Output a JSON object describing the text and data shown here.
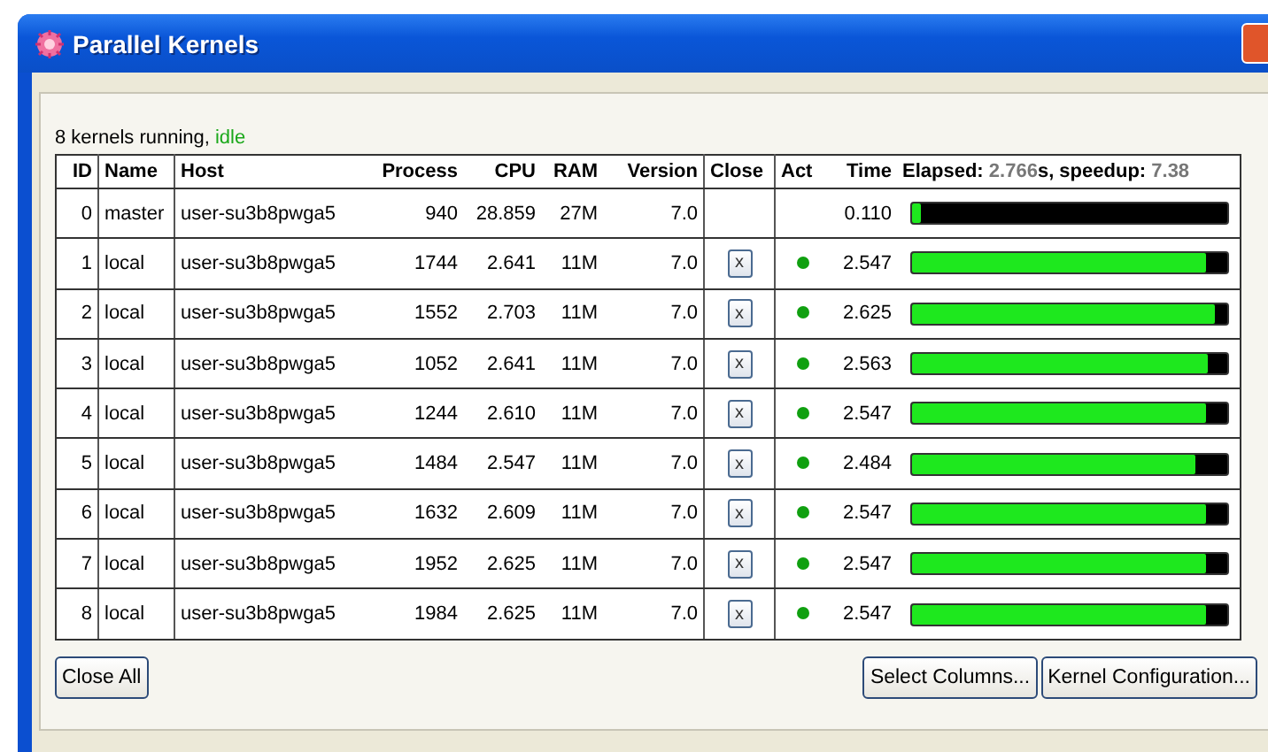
{
  "window": {
    "title": "Parallel Kernels"
  },
  "status": {
    "text": "8 kernels running,",
    "state": "idle"
  },
  "table": {
    "columns": [
      "ID",
      "Name",
      "Host",
      "Process",
      "CPU",
      "RAM",
      "Version",
      "Close",
      "Act",
      "Time"
    ],
    "elapsed_header": [
      {
        "kind": "label",
        "text": "Elapsed:"
      },
      {
        "kind": "value",
        "text": "2.766"
      },
      {
        "kind": "label",
        "text": "s, speedup:"
      },
      {
        "kind": "value",
        "text": "7.38"
      }
    ],
    "rows": [
      {
        "id": "0",
        "name": "master",
        "host": "user-su3b8pwga5",
        "process": "940",
        "cpu": "28.859",
        "ram": "27M",
        "version": "7.0",
        "active": false,
        "time": "0.110",
        "level": 0.03
      },
      {
        "id": "1",
        "name": "local",
        "host": "user-su3b8pwga5",
        "process": "1744",
        "cpu": "2.641",
        "ram": "11M",
        "version": "7.0",
        "close_button": "x",
        "active": true,
        "time": "2.547",
        "level": 0.93
      },
      {
        "id": "2",
        "name": "local",
        "host": "user-su3b8pwga5",
        "process": "1552",
        "cpu": "2.703",
        "ram": "11M",
        "version": "7.0",
        "close_button": "x",
        "active": true,
        "time": "2.625",
        "level": 0.96
      },
      {
        "id": "3",
        "name": "local",
        "host": "user-su3b8pwga5",
        "process": "1052",
        "cpu": "2.641",
        "ram": "11M",
        "version": "7.0",
        "close_button": "x",
        "active": true,
        "time": "2.563",
        "level": 0.94
      },
      {
        "id": "4",
        "name": "local",
        "host": "user-su3b8pwga5",
        "process": "1244",
        "cpu": "2.610",
        "ram": "11M",
        "version": "7.0",
        "close_button": "x",
        "active": true,
        "time": "2.547",
        "level": 0.93
      },
      {
        "id": "5",
        "name": "local",
        "host": "user-su3b8pwga5",
        "process": "1484",
        "cpu": "2.547",
        "ram": "11M",
        "version": "7.0",
        "close_button": "x",
        "active": true,
        "time": "2.484",
        "level": 0.9
      },
      {
        "id": "6",
        "name": "local",
        "host": "user-su3b8pwga5",
        "process": "1632",
        "cpu": "2.609",
        "ram": "11M",
        "version": "7.0",
        "close_button": "x",
        "active": true,
        "time": "2.547",
        "level": 0.93
      },
      {
        "id": "7",
        "name": "local",
        "host": "user-su3b8pwga5",
        "process": "1952",
        "cpu": "2.625",
        "ram": "11M",
        "version": "7.0",
        "close_button": "x",
        "active": true,
        "time": "2.547",
        "level": 0.93
      },
      {
        "id": "8",
        "name": "local",
        "host": "user-su3b8pwga5",
        "process": "1984",
        "cpu": "2.625",
        "ram": "11M",
        "version": "7.0",
        "close_button": "x",
        "active": true,
        "time": "2.547",
        "level": 0.93
      }
    ]
  },
  "buttons": {
    "left": [
      "Close All"
    ],
    "right": [
      "Select Columns...",
      "Kernel Configuration..."
    ]
  }
}
